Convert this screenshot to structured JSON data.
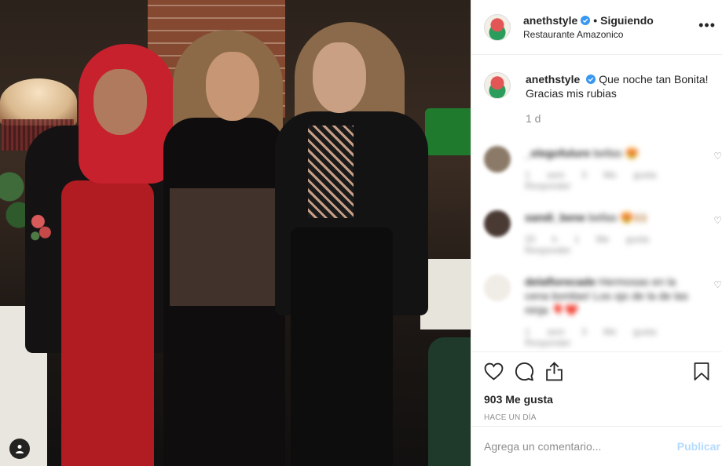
{
  "post": {
    "username": "anethstyle",
    "follow_separator": "•",
    "follow_status": "Siguiendo",
    "location": "Restaurante Amazonico",
    "more_icon": "more-horizontal-icon"
  },
  "caption": {
    "username": "anethstyle",
    "text": "Que noche tan Bonita! Gracias mis rubias",
    "time": "1 d"
  },
  "blurred_comments": [
    {
      "user": "_elegofulure",
      "text": "bellas 😍",
      "meta": "1 sem 3 Me gusta Responder",
      "avatar_color": "#8c7a68"
    },
    {
      "user": "sandi_bene",
      "text": "bellas 😍🙌🏼",
      "meta": "20 h 1 Me gusta Responder",
      "avatar_color": "#4a3a34"
    },
    {
      "user": "delaflorecade",
      "text": "Hermosas en la cena bonitas! Los ojo de la de las ninja 🎈❤️",
      "meta": "1 sem 3 Me gusta Responder",
      "avatar_color": "#f0ece6"
    }
  ],
  "actions": {
    "likes": "903 Me gusta",
    "time_ago": "HACE UN DÍA"
  },
  "comment_box": {
    "placeholder": "Agrega un comentario...",
    "submit": "Publicar"
  },
  "colors": {
    "verified": "#3897f0",
    "publish_disabled": "#b3dbff",
    "muted": "#8e8e8e"
  }
}
